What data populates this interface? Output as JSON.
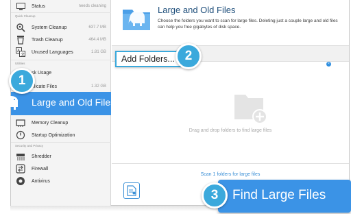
{
  "sidebar": {
    "status": {
      "label": "Status",
      "value": "needs cleaning"
    },
    "sections": {
      "quick_cleanup": "Quick Cleanup",
      "utilities": "Utilities",
      "security": "Security and Privacy"
    },
    "items": [
      {
        "label": "System Cleanup",
        "value": "637.7 MB"
      },
      {
        "label": "Trash Cleanup",
        "value": "464.4 MB"
      },
      {
        "label": "Unused Languages",
        "value": "1.81 GB"
      },
      {
        "label": "Disk Usage",
        "value": ""
      },
      {
        "label": "Duplicate Files",
        "value": "1.32 GB"
      },
      {
        "label": "Large and Old Files",
        "value": ""
      },
      {
        "label": "Memory Cleanup",
        "value": ""
      },
      {
        "label": "Startup Optimization",
        "value": ""
      },
      {
        "label": "Shredder",
        "value": ""
      },
      {
        "label": "Firewall",
        "value": ""
      },
      {
        "label": "Antivirus",
        "value": ""
      }
    ],
    "disk_usage_visible": "sk Usage",
    "duplicate_visible": "plicate Files"
  },
  "callouts": [
    "1",
    "2",
    "3"
  ],
  "main": {
    "title": "Large and Old Files",
    "description": "Choose the folders you want to scan for large files. Deleting just a couple large and old files can help you free gigabytes of disk space.",
    "add_folders_label": "Add Folders...",
    "close_glyph": "×",
    "drop_hint": "Drag and drop folders to find large files",
    "scan_link": "Scan 1 folders for large files",
    "find_button": "Find Large Files"
  },
  "colors": {
    "accent": "#3b93e6",
    "callout": "#3ba9dc",
    "link": "#3a8fd6"
  }
}
